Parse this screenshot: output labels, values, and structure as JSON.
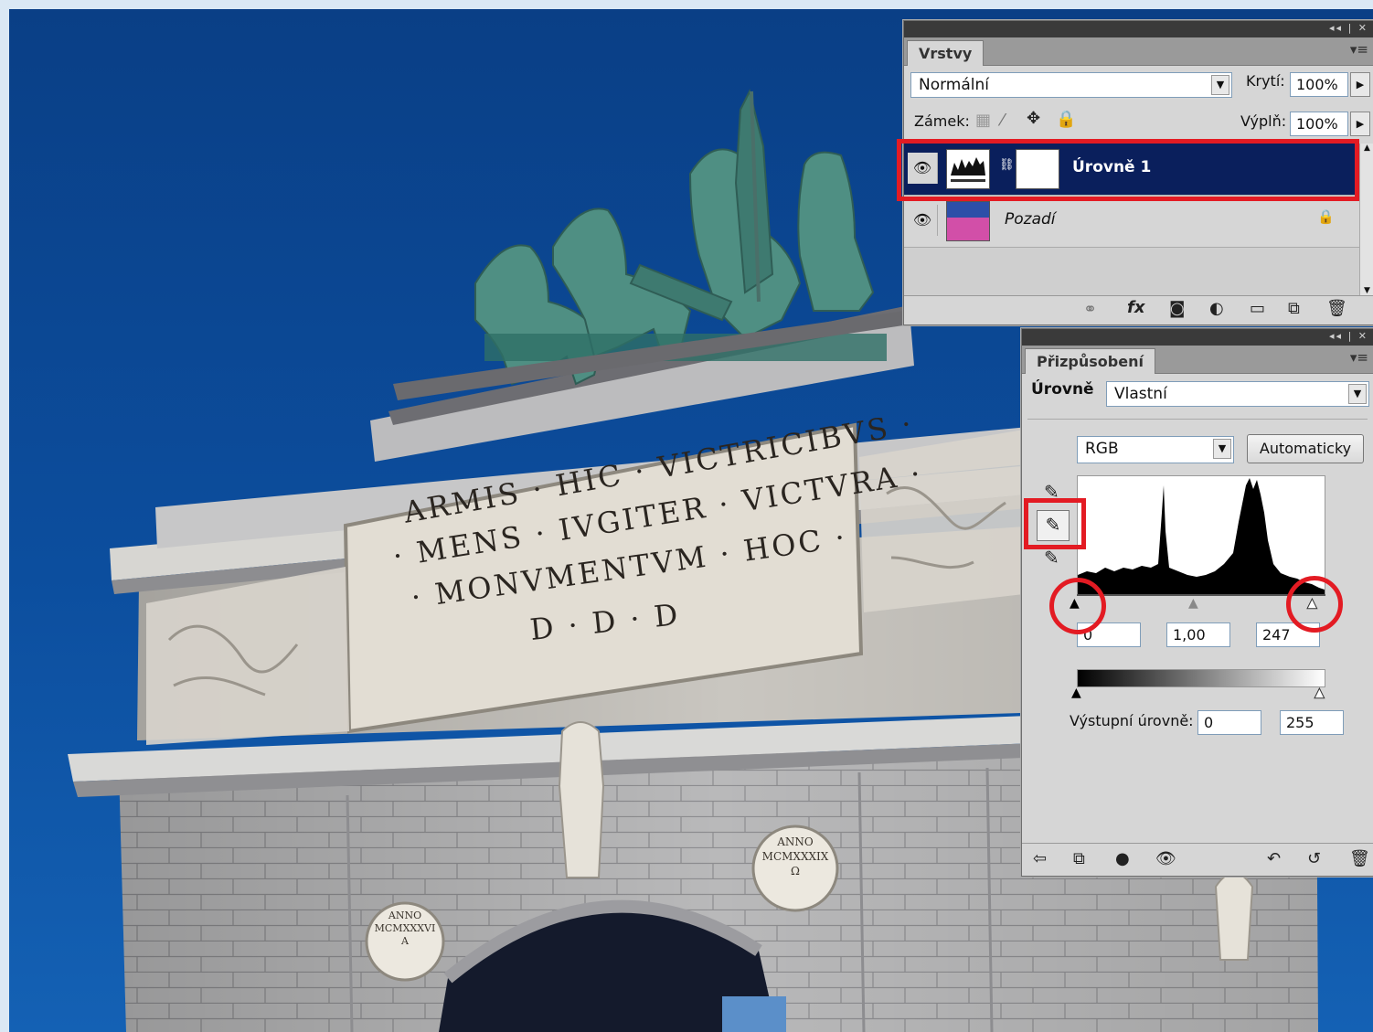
{
  "photo": {
    "inscription": [
      "ARMIS · HIC · VICTRICIBVS ·",
      "· MENS · IVGITER · VICTVRA ·",
      "· MONVMENTVM · HOC ·",
      "D · D · D"
    ],
    "medallion_left": [
      "ANNO",
      "MCMXXXVI",
      "A"
    ],
    "medallion_right": [
      "ANNO",
      "MCMXXXIX",
      "Ω"
    ]
  },
  "layers": {
    "tab": "Vrstvy",
    "blend_mode": "Normální",
    "opacity_label": "Krytí:",
    "opacity_value": "100%",
    "lock_label": "Zámek:",
    "fill_label": "Výplň:",
    "fill_value": "100%",
    "items": [
      {
        "name": "Úrovně 1",
        "selected": true
      },
      {
        "name": "Pozadí",
        "locked": true
      }
    ],
    "footer_icons": [
      "link-icon",
      "fx-icon",
      "mask-icon",
      "adjustment-icon",
      "folder-icon",
      "new-layer-icon",
      "trash-icon"
    ]
  },
  "adjustments": {
    "tab": "Přizpůsobení",
    "type_label": "Úrovně",
    "preset": "Vlastní",
    "channel": "RGB",
    "auto_button": "Automaticky",
    "input_black": "0",
    "input_gamma": "1,00",
    "input_white": "247",
    "output_label": "Výstupní úrovně:",
    "output_black": "0",
    "output_white": "255"
  },
  "colors": {
    "highlight": "#e31b23",
    "selected_layer": "#0a1f5c",
    "sky": "#0c4e9e"
  }
}
